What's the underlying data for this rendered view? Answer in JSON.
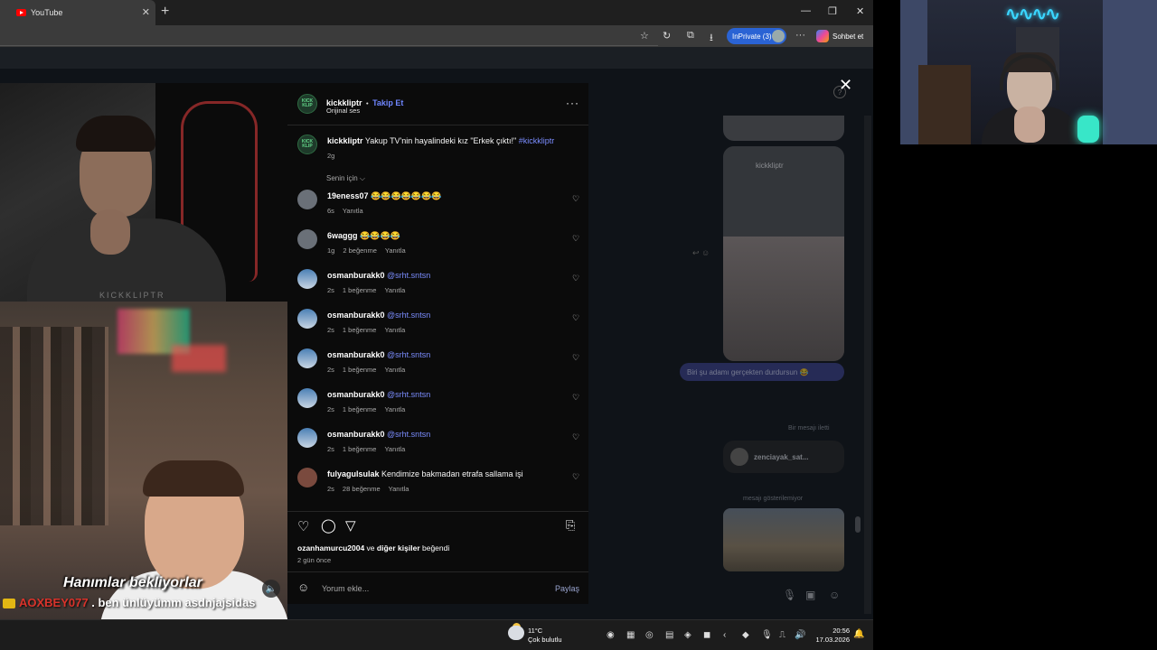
{
  "browser": {
    "tab_title": "YouTube",
    "tab_close": "✕",
    "new_tab": "+",
    "window_minimize": "—",
    "window_restore": "❐",
    "window_close": "✕",
    "inprivate_label": "InPrivate (3)",
    "chat_label": "Sohbet et"
  },
  "video": {
    "watermark": "KICKKLIPTR",
    "caption": "Hanımlar bekliyorlar",
    "chat_user": "AOXBEY077",
    "chat_message": ". ben ünlüyümm asdnjajsidas"
  },
  "post": {
    "account": "kickkliptr",
    "avatar_text": "KICK KLIP",
    "separator": "•",
    "follow_label": "Takip Et",
    "audio_label": "Orijinal ses",
    "more_label": "···",
    "caption_user": "kickkliptr",
    "caption_text": "Yakup TV'nin hayalindeki kız \"Erkek çıktı!\"",
    "caption_hashtag": "#kickkliptr",
    "caption_age": "2g",
    "filter_label": "Senin için ⌵",
    "comments": [
      {
        "user": "19eness07",
        "text": "😂😂😂😂😂😂😂",
        "mention": "",
        "age": "6s",
        "likes": "",
        "reply": "Yanıtla",
        "avatar": "photo"
      },
      {
        "user": "6waggg",
        "text": "😂😂😂😂",
        "mention": "",
        "age": "1g",
        "likes": "2 beğenme",
        "reply": "Yanıtla",
        "avatar": "photo"
      },
      {
        "user": "osmanburakk0",
        "text": "",
        "mention": "@srht.sntsn",
        "age": "2s",
        "likes": "1 beğenme",
        "reply": "Yanıtla",
        "avatar": "sky"
      },
      {
        "user": "osmanburakk0",
        "text": "",
        "mention": "@srht.sntsn",
        "age": "2s",
        "likes": "1 beğenme",
        "reply": "Yanıtla",
        "avatar": "sky"
      },
      {
        "user": "osmanburakk0",
        "text": "",
        "mention": "@srht.sntsn",
        "age": "2s",
        "likes": "1 beğenme",
        "reply": "Yanıtla",
        "avatar": "sky"
      },
      {
        "user": "osmanburakk0",
        "text": "",
        "mention": "@srht.sntsn",
        "age": "2s",
        "likes": "1 beğenme",
        "reply": "Yanıtla",
        "avatar": "sky"
      },
      {
        "user": "osmanburakk0",
        "text": "",
        "mention": "@srht.sntsn",
        "age": "2s",
        "likes": "1 beğenme",
        "reply": "Yanıtla",
        "avatar": "sky"
      },
      {
        "user": "fulyagulsulak",
        "text": "Kendimize bakmadan etrafa sallama işi",
        "mention": "",
        "age": "2s",
        "likes": "28 beğenme",
        "reply": "Yanıtla",
        "avatar": "girl"
      }
    ],
    "liked_by_user": "ozanhamurcu2004",
    "liked_by_joiner": "ve",
    "liked_by_others": "diğer kişiler",
    "liked_by_suffix": "beğendi",
    "post_date": "2 gün önce",
    "comment_placeholder": "Yorum ekle...",
    "share_label": "Paylaş"
  },
  "dm": {
    "reel_account": "kickkliptr",
    "bubble_text": "Biri şu adamı gerçekten durdursun 😂",
    "faint_1": "Bir mesajı iletti",
    "card_user": "zenciayak_sat...",
    "faint_2": "mesajı gösterilemiyor"
  },
  "taskbar": {
    "temperature": "11°C",
    "weather": "Çok bulutlu",
    "time": "20:56",
    "date": "17.03.2026"
  },
  "icons": {
    "close": "✕",
    "heart": "♡",
    "comment": "◯",
    "share": "▽",
    "save": "🔖",
    "emoji": "☺",
    "mute": "🔈"
  }
}
